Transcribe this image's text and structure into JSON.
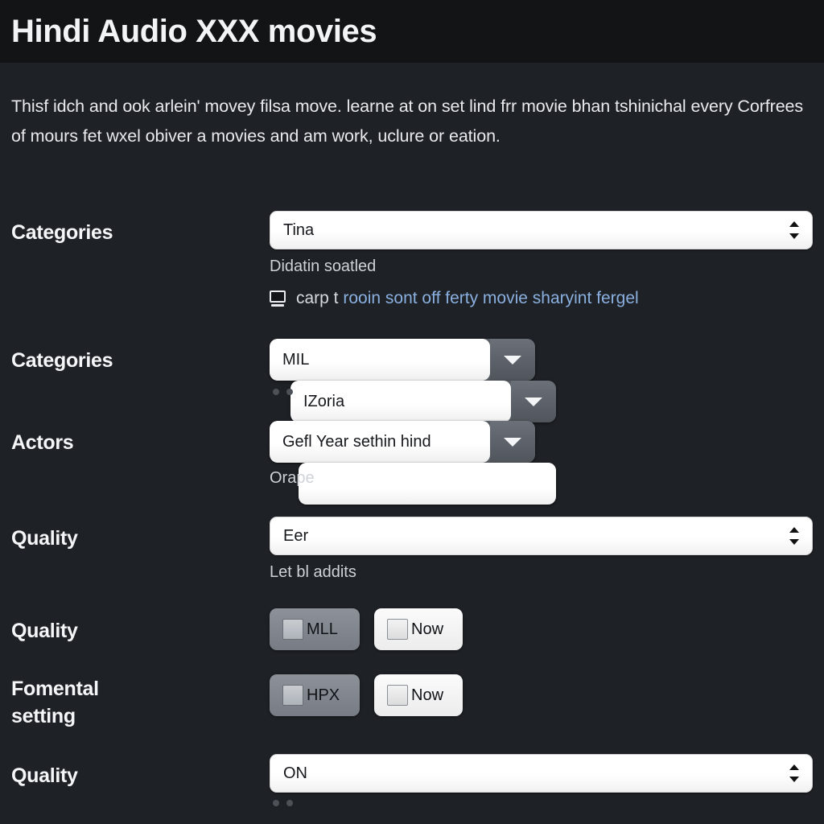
{
  "header": {
    "title": "Hindi Audio XXX movies"
  },
  "intro": {
    "paragraph": "Thisf idch and ook arlein' movey filsa move. learne at on set lind frr movie bhan tshinichal every Corfrees of mours fet wxel obiver a movies and am work, uclure or eation."
  },
  "form": {
    "rows": [
      {
        "label": "Categories",
        "control": "select",
        "value": "Tina",
        "helper": "Didatin soatled",
        "link": {
          "icon": "monitor-icon",
          "lead": "carp t",
          "text": "rooin sont off ferty movie sharyint fergel"
        }
      },
      {
        "label": "Categories",
        "control": "combo-pair",
        "value_left": "MIL",
        "value_right": "IZoria",
        "dots": 2
      },
      {
        "label": "Actors",
        "control": "combo-plain",
        "value_left": "Gefl Year sethin hind",
        "value_right": "",
        "helper": "Orape"
      },
      {
        "label": "Quality",
        "control": "select",
        "value": "Eer",
        "helper": "Let bl addits"
      },
      {
        "label": "Quality",
        "control": "checkbuttons",
        "buttons": [
          {
            "label": "MLL",
            "style": "dark"
          },
          {
            "label": "Now",
            "style": "light"
          }
        ]
      },
      {
        "label": "Fomental\nsetting",
        "control": "checkbuttons",
        "buttons": [
          {
            "label": "HPX",
            "style": "dark"
          },
          {
            "label": "Now",
            "style": "light"
          }
        ]
      },
      {
        "label": "Quality",
        "control": "select",
        "value": "ON",
        "dots": 2
      }
    ]
  },
  "colors": {
    "page_background": "#1e2126",
    "header_background": "#121416",
    "title_text": "#f3f4f6",
    "link_text": "#8ab0e0",
    "field_face": "#ffffff",
    "combo_arrow_button": "#5a5f66"
  }
}
